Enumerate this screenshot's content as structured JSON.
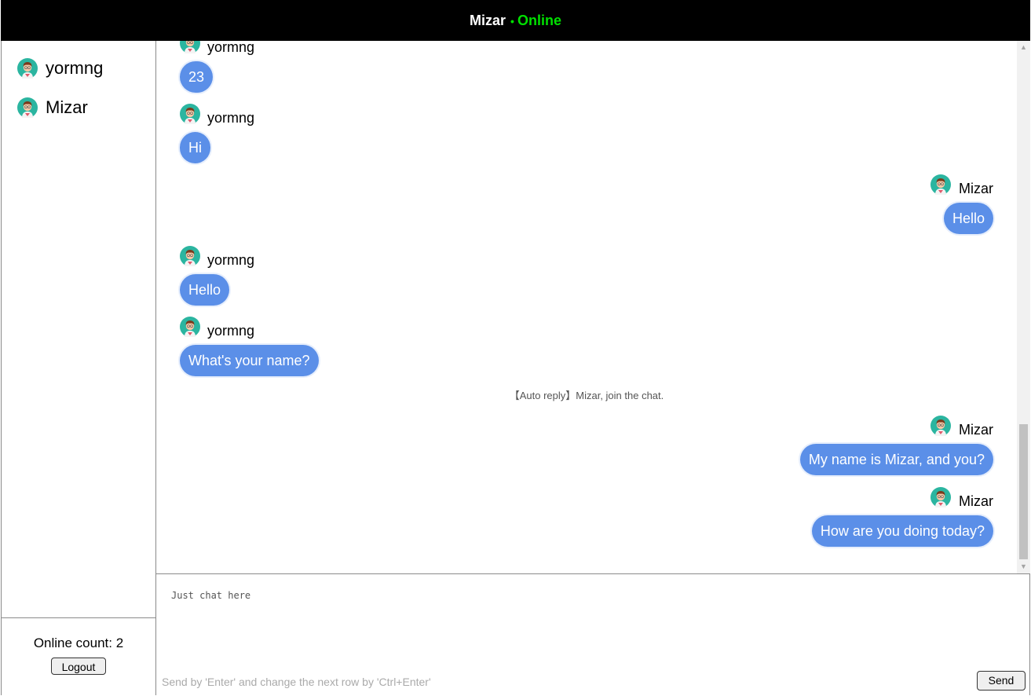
{
  "header": {
    "username": "Mizar",
    "status": "Online",
    "status_color": "#00e000"
  },
  "sidebar": {
    "users": [
      {
        "name": "yormng",
        "avatar": "avatar-icon"
      },
      {
        "name": "Mizar",
        "avatar": "avatar-icon"
      }
    ],
    "online_count_label": "Online count: 2",
    "logout_label": "Logout"
  },
  "chat": {
    "messages": [
      {
        "side": "left",
        "sender": "yormng",
        "text": "23"
      },
      {
        "side": "left",
        "sender": "yormng",
        "text": "Hi"
      },
      {
        "side": "right",
        "sender": "Mizar",
        "text": "Hello"
      },
      {
        "side": "left",
        "sender": "yormng",
        "text": "Hello"
      },
      {
        "side": "left",
        "sender": "yormng",
        "text": "What's your name?"
      },
      {
        "side": "system",
        "text": "【Auto reply】Mizar, join the chat."
      },
      {
        "side": "right",
        "sender": "Mizar",
        "text": "My name is Mizar, and you?"
      },
      {
        "side": "right",
        "sender": "Mizar",
        "text": "How are you doing today?"
      }
    ],
    "bubble_color": "#5b8fe8"
  },
  "composer": {
    "placeholder": "Just chat here",
    "hint": "Send by 'Enter' and change the next row by 'Ctrl+Enter'",
    "send_label": "Send"
  }
}
